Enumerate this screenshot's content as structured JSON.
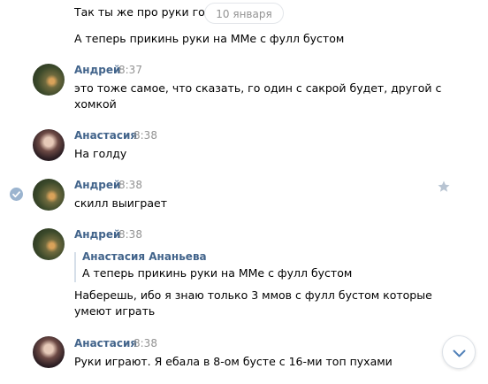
{
  "date_separator": "10 января",
  "messages": [
    {
      "lines": [
        "Так ты же про руки говорил"
      ]
    },
    {
      "lines": [
        "А теперь прикинь руки на ММе с фулл бустом"
      ]
    },
    {
      "author": "Андрей",
      "time": "8:37",
      "lines": [
        "это тоже самое, что сказать, го один с сакрой будет, другой с",
        "хомкой"
      ]
    },
    {
      "author": "Анастасия",
      "time": "8:38",
      "lines": [
        "На голду"
      ]
    },
    {
      "author": "Андрей",
      "time": "8:38",
      "lines": [
        "скилл выиграет"
      ]
    },
    {
      "author": "Андрей",
      "time": "8:38",
      "quote": {
        "author": "Анастасия Ананьева",
        "text": "А теперь прикинь руки на ММе с фулл бустом"
      },
      "lines": [
        "Наберешь, ибо я знаю только 3 ммов с фулл бустом которые",
        "умеют играть"
      ]
    },
    {
      "author": "Анастасия",
      "time": "8:38",
      "lines": [
        "Руки играют. Я ебала в 8-ом бусте с 16-ми топ пухами"
      ]
    }
  ],
  "icons": {
    "selected": "check-circle-icon",
    "favorite": "star-icon",
    "scroll_down": "chevron-down-icon"
  },
  "colors": {
    "name": "#42648b",
    "time": "#939393",
    "quote_bar": "#d6dfe9",
    "selected_check": "#9bb4cf"
  }
}
